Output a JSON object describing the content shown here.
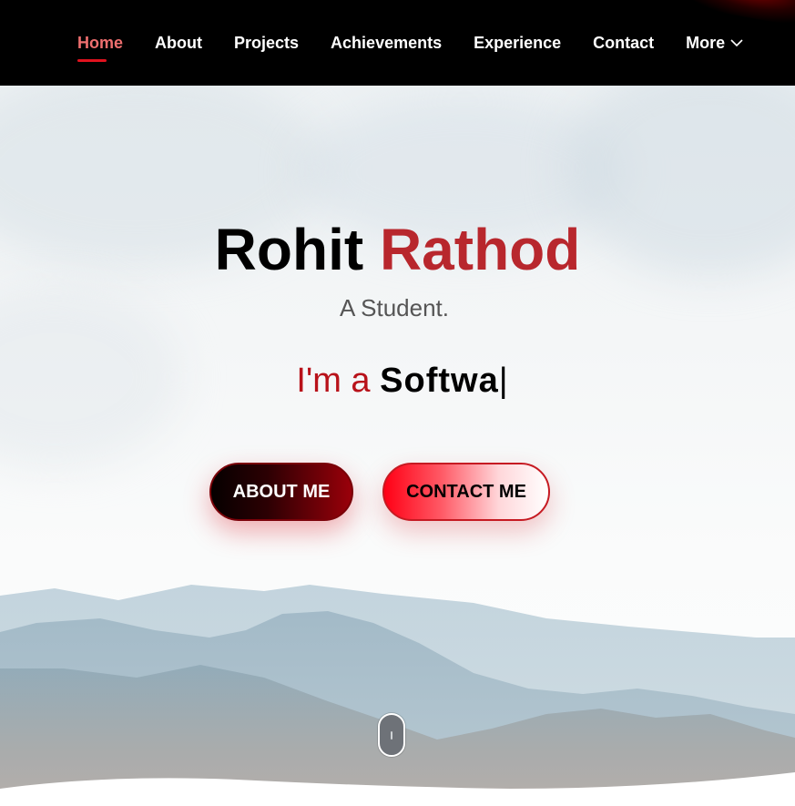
{
  "nav": {
    "items": [
      {
        "label": "Home",
        "active": true
      },
      {
        "label": "About",
        "active": false
      },
      {
        "label": "Projects",
        "active": false
      },
      {
        "label": "Achievements",
        "active": false
      },
      {
        "label": "Experience",
        "active": false
      },
      {
        "label": "Contact",
        "active": false
      }
    ],
    "more_label": "More",
    "more_icon": "chevron-down-icon"
  },
  "hero": {
    "first_name": "Rohit",
    "last_name": "Rathod",
    "subtitle": "A Student.",
    "typing_prefix": "I'm a",
    "typing_word": "Softwa",
    "cursor": "|",
    "about_button": "ABOUT ME",
    "contact_button": "CONTACT ME"
  },
  "colors": {
    "nav_background": "#000000",
    "accent_red": "#b8272d",
    "active_nav": "#ef6f6f",
    "underline": "#e0121e"
  }
}
